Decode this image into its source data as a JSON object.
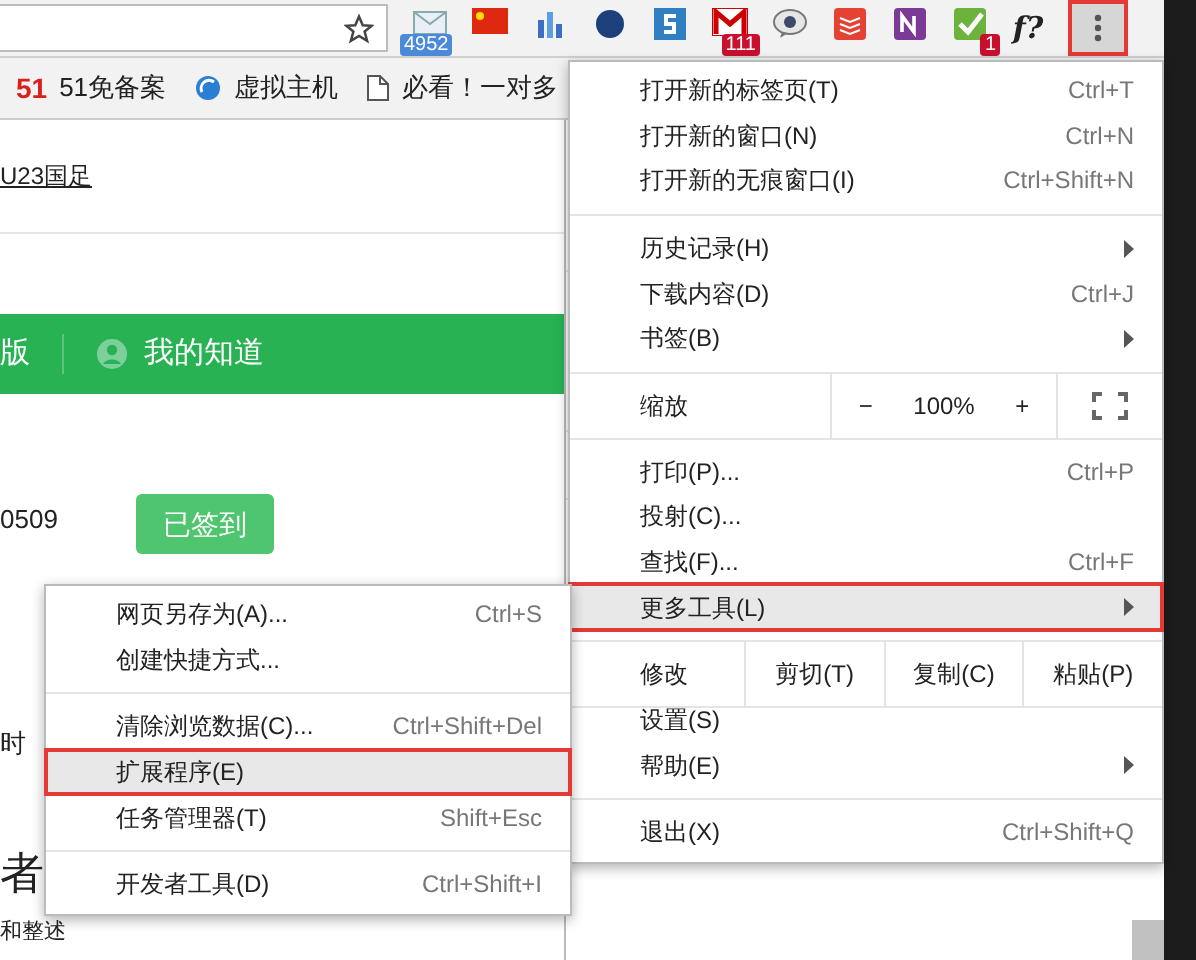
{
  "toolbar": {
    "extensions": [
      {
        "kind": "mail",
        "badge": "4952"
      },
      {
        "kind": "flag"
      },
      {
        "kind": "bars"
      },
      {
        "kind": "circle"
      },
      {
        "kind": "s"
      },
      {
        "kind": "m",
        "badge": "111"
      },
      {
        "kind": "bubble"
      },
      {
        "kind": "todo"
      },
      {
        "kind": "note"
      },
      {
        "kind": "check",
        "badge": "1"
      },
      {
        "kind": "text",
        "label": "f?"
      }
    ],
    "menu_button": {
      "annotated": true
    }
  },
  "bookmarks": [
    {
      "kind": "logo",
      "logo": "51",
      "label": "51免备案"
    },
    {
      "kind": "swirl",
      "label": "虚拟主机"
    },
    {
      "kind": "doc",
      "label": "必看！一对多"
    }
  ],
  "page": {
    "headline_link": "U23国足",
    "nav": [
      {
        "label": "版",
        "icon": false
      },
      {
        "label": "我的知道",
        "icon": true
      }
    ],
    "number": "0509",
    "signed_button": "已签到",
    "fragments": [
      "时",
      "者",
      "和整述"
    ]
  },
  "main_menu": [
    {
      "kind": "item",
      "label": "打开新的标签页(T)",
      "shortcut": "Ctrl+T",
      "selected": false,
      "annotated": false,
      "submenu": false
    },
    {
      "kind": "item",
      "label": "打开新的窗口(N)",
      "shortcut": "Ctrl+N",
      "selected": false,
      "annotated": false,
      "submenu": false
    },
    {
      "kind": "item",
      "label": "打开新的无痕窗口(I)",
      "shortcut": "Ctrl+Shift+N",
      "selected": false,
      "annotated": false,
      "submenu": false
    },
    {
      "kind": "divider"
    },
    {
      "kind": "item",
      "label": "历史记录(H)",
      "selected": false,
      "annotated": false,
      "submenu": true
    },
    {
      "kind": "item",
      "label": "下载内容(D)",
      "shortcut": "Ctrl+J",
      "selected": false,
      "annotated": false,
      "submenu": false
    },
    {
      "kind": "item",
      "label": "书签(B)",
      "selected": false,
      "annotated": false,
      "submenu": true
    },
    {
      "kind": "divider"
    },
    {
      "kind": "zoom",
      "label": "缩放",
      "minus": "−",
      "value": "100%",
      "plus": "+"
    },
    {
      "kind": "divider"
    },
    {
      "kind": "item",
      "label": "打印(P)...",
      "shortcut": "Ctrl+P",
      "selected": false,
      "annotated": false,
      "submenu": false
    },
    {
      "kind": "item",
      "label": "投射(C)...",
      "selected": false,
      "annotated": false,
      "submenu": false
    },
    {
      "kind": "item",
      "label": "查找(F)...",
      "shortcut": "Ctrl+F",
      "selected": false,
      "annotated": false,
      "submenu": false
    },
    {
      "kind": "item",
      "label": "更多工具(L)",
      "selected": true,
      "annotated": true,
      "submenu": true
    },
    {
      "kind": "divider"
    },
    {
      "kind": "edit",
      "label": "修改",
      "buttons": [
        "剪切(T)",
        "复制(C)",
        "粘贴(P)"
      ]
    },
    {
      "kind": "item",
      "label": "设置(S)",
      "selected": false,
      "annotated": false,
      "submenu": false
    },
    {
      "kind": "item",
      "label": "帮助(E)",
      "selected": false,
      "annotated": false,
      "submenu": true
    },
    {
      "kind": "divider"
    },
    {
      "kind": "item",
      "label": "退出(X)",
      "shortcut": "Ctrl+Shift+Q",
      "selected": false,
      "annotated": false,
      "submenu": false
    }
  ],
  "more_tools_menu": [
    {
      "kind": "item",
      "label": "网页另存为(A)...",
      "shortcut": "Ctrl+S",
      "selected": false,
      "annotated": false
    },
    {
      "kind": "item",
      "label": "创建快捷方式...",
      "selected": false,
      "annotated": false
    },
    {
      "kind": "divider"
    },
    {
      "kind": "item",
      "label": "清除浏览数据(C)...",
      "shortcut": "Ctrl+Shift+Del",
      "selected": false,
      "annotated": false
    },
    {
      "kind": "item",
      "label": "扩展程序(E)",
      "selected": true,
      "annotated": true
    },
    {
      "kind": "item",
      "label": "任务管理器(T)",
      "shortcut": "Shift+Esc",
      "selected": false,
      "annotated": false
    },
    {
      "kind": "divider"
    },
    {
      "kind": "item",
      "label": "开发者工具(D)",
      "shortcut": "Ctrl+Shift+I",
      "selected": false,
      "annotated": false
    }
  ]
}
